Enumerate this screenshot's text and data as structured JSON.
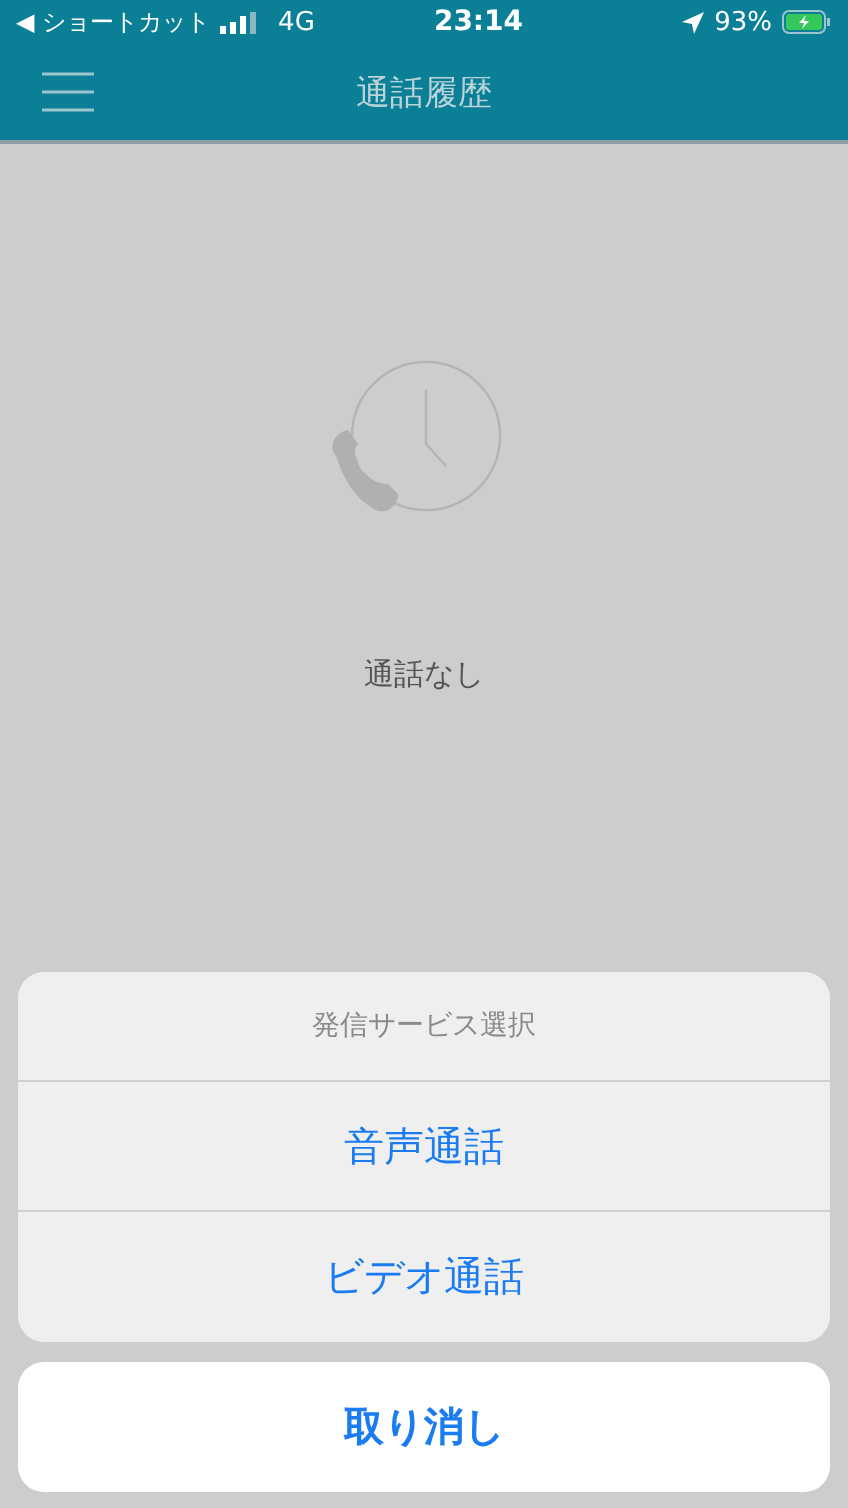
{
  "status_bar": {
    "back": "◀ ショートカット",
    "network": "4G",
    "time": "23:14",
    "battery": "93%"
  },
  "header": {
    "title": "通話履歴"
  },
  "empty_state": {
    "message": "通話なし"
  },
  "action_sheet": {
    "title": "発信サービス選択",
    "actions": [
      "音声通話",
      "ビデオ通話"
    ],
    "cancel": "取り消し"
  }
}
